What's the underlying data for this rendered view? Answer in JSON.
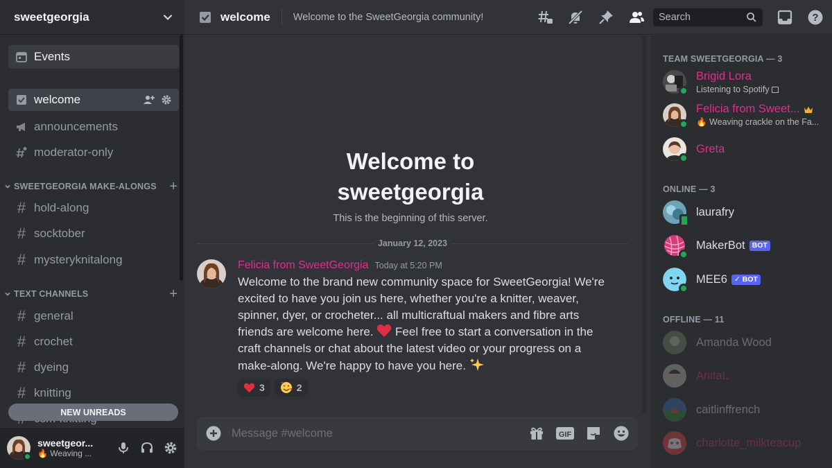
{
  "server": {
    "name": "sweetgeorgia"
  },
  "sidebar": {
    "events_label": "Events",
    "channels_top": [
      {
        "name": "welcome",
        "active": true
      },
      {
        "name": "announcements"
      },
      {
        "name": "moderator-only"
      }
    ],
    "categories": [
      {
        "label": "SWEETGEORGIA MAKE-ALONGS",
        "channels": [
          "hold-along",
          "socktober",
          "mysteryknitalong"
        ]
      },
      {
        "label": "TEXT CHANNELS",
        "channels": [
          "general",
          "crochet",
          "dyeing",
          "knitting",
          "csm-knitting"
        ]
      }
    ],
    "new_unreads": "NEW UNREADS"
  },
  "user_panel": {
    "name": "sweetgeor...",
    "status": "Weaving ..."
  },
  "topbar": {
    "channel": "welcome",
    "topic": "Welcome to the SweetGeorgia community!",
    "search_placeholder": "Search"
  },
  "chat": {
    "welcome_title_line1": "Welcome to",
    "welcome_title_line2": "sweetgeorgia",
    "welcome_sub": "This is the beginning of this server.",
    "date": "January 12, 2023",
    "message": {
      "author": "Felicia from SweetGeorgia",
      "time": "Today at 5:20 PM",
      "text_part1": "Welcome to the brand new community space for SweetGeorgia! We're excited to have you join us here, whether you're a knitter, weaver, spinner, dyer, or crocheter... all multicraftual makers and fibre arts friends are welcome here. ",
      "text_part2": " Feel free to start a conversation in the craft channels or chat about the latest video or your progress on a make-along. We're happy to have you here. ",
      "reactions": [
        {
          "emoji": "heart",
          "count": "3"
        },
        {
          "emoji": "smiling-face-with-hearts",
          "count": "2"
        }
      ]
    },
    "composer_placeholder": "Message #welcome"
  },
  "members": {
    "groups": [
      {
        "label": "TEAM SWEETGEORGIA — 3"
      },
      {
        "label": "ONLINE — 3"
      },
      {
        "label": "OFFLINE — 11"
      }
    ],
    "team": [
      {
        "name": "Brigid Lora",
        "status": "Listening to Spotify"
      },
      {
        "name": "Felicia from Sweet...",
        "status": "Weaving crackle on the Fa..."
      },
      {
        "name": "Greta",
        "status": ""
      }
    ],
    "online": [
      {
        "name": "laurafry"
      },
      {
        "name": "MakerBot",
        "tag": "BOT"
      },
      {
        "name": "MEE6",
        "tag": "✓ BOT"
      }
    ],
    "offline": [
      {
        "name": "Amanda Wood"
      },
      {
        "name": "AnitaL"
      },
      {
        "name": "caitlinffrench"
      },
      {
        "name": "charlotte_milkteacup"
      }
    ]
  },
  "colors": {
    "accent": "#5865f2",
    "role_pink": "#e12d8f",
    "online": "#23a55a",
    "background": "#313338",
    "sidebar": "#2b2d31"
  }
}
